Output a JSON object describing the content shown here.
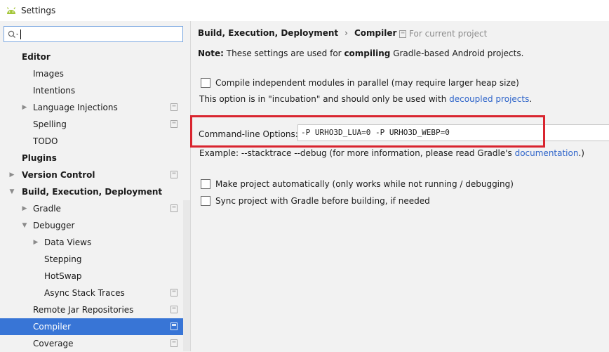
{
  "window": {
    "title": "Settings"
  },
  "search": {
    "placeholder": ""
  },
  "tree": [
    {
      "label": "Editor",
      "level": 0,
      "bold": true,
      "arrow": "",
      "project": false
    },
    {
      "label": "Images",
      "level": 1,
      "bold": false,
      "arrow": "",
      "project": false
    },
    {
      "label": "Intentions",
      "level": 1,
      "bold": false,
      "arrow": "",
      "project": false
    },
    {
      "label": "Language Injections",
      "level": 1,
      "bold": false,
      "arrow": "right",
      "project": true
    },
    {
      "label": "Spelling",
      "level": 1,
      "bold": false,
      "arrow": "",
      "project": true
    },
    {
      "label": "TODO",
      "level": 1,
      "bold": false,
      "arrow": "",
      "project": false
    },
    {
      "label": "Plugins",
      "level": 0,
      "bold": true,
      "arrow": "",
      "project": false
    },
    {
      "label": "Version Control",
      "level": 0,
      "bold": true,
      "arrow": "right",
      "project": true
    },
    {
      "label": "Build, Execution, Deployment",
      "level": 0,
      "bold": true,
      "arrow": "down",
      "project": false
    },
    {
      "label": "Gradle",
      "level": 1,
      "bold": false,
      "arrow": "right",
      "project": true
    },
    {
      "label": "Debugger",
      "level": 1,
      "bold": false,
      "arrow": "down",
      "project": false
    },
    {
      "label": "Data Views",
      "level": 2,
      "bold": false,
      "arrow": "right",
      "project": false
    },
    {
      "label": "Stepping",
      "level": 2,
      "bold": false,
      "arrow": "",
      "project": false
    },
    {
      "label": "HotSwap",
      "level": 2,
      "bold": false,
      "arrow": "",
      "project": false
    },
    {
      "label": "Async Stack Traces",
      "level": 2,
      "bold": false,
      "arrow": "",
      "project": true
    },
    {
      "label": "Remote Jar Repositories",
      "level": 1,
      "bold": false,
      "arrow": "",
      "project": true
    },
    {
      "label": "Compiler",
      "level": 1,
      "bold": false,
      "arrow": "",
      "project": true,
      "selected": true
    },
    {
      "label": "Coverage",
      "level": 1,
      "bold": false,
      "arrow": "",
      "project": true
    }
  ],
  "breadcrumb": {
    "parent": "Build, Execution, Deployment",
    "separator": "›",
    "current": "Compiler",
    "scope": "For current project"
  },
  "note": {
    "prefix": "Note:",
    "text1": " These settings are used for ",
    "bold": "compiling",
    "text2": " Gradle-based Android projects."
  },
  "parallel": {
    "label": "Compile independent modules in parallel (may require larger heap size)",
    "checked": false,
    "hint_text": "This option is in \"incubation\" and should only be used with ",
    "hint_link": "decoupled projects",
    "hint_end": "."
  },
  "command_line": {
    "label": "Command-line Options:",
    "value": "-P URHO3D_LUA=0 -P URHO3D_WEBP=0",
    "example_text": "Example: --stacktrace --debug (for more information, please read Gradle's ",
    "example_link": "documentation",
    "example_end": ".)"
  },
  "make_auto": {
    "label": "Make project automatically (only works while not running / debugging)",
    "checked": false
  },
  "sync_gradle": {
    "label": "Sync project with Gradle before building, if needed",
    "checked": false
  },
  "colors": {
    "selection": "#3875d6",
    "link": "#2f65ca",
    "highlight": "#d9252f",
    "android": "#a4c639"
  }
}
